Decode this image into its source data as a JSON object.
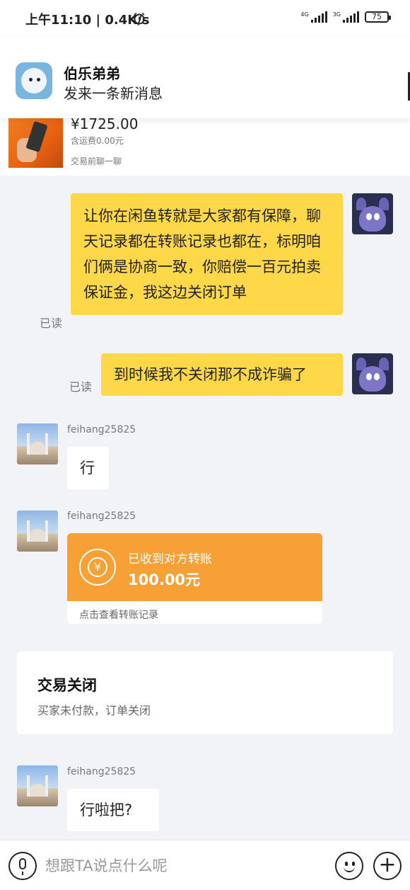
{
  "status_bar": {
    "time": "上午11:10 | 0.4K/s",
    "alarm_icon": "alarm-clock-icon",
    "net1": "4G",
    "net2": "3G",
    "battery": "75"
  },
  "notification": {
    "title": "伯乐弟弟",
    "body": "发来一条新消息",
    "app_icon": "app-mascot-icon"
  },
  "product": {
    "price": "¥1725.00",
    "shipping": "含运费0.00元",
    "chat_hint": "交易前聊一聊"
  },
  "messages": {
    "m1": {
      "text": "让你在闲鱼转就是大家都有保障，聊天记录都在转账记录也都在，标明咱们俩是协商一致，你赔偿一百元拍卖保证金，我这边关闭订单",
      "read": "已读"
    },
    "m2": {
      "text": "到时候我不关闭那不成诈骗了",
      "read": "已读"
    },
    "m3": {
      "nick": "feihang25825",
      "text": "行"
    },
    "m4": {
      "nick": "feihang25825",
      "transfer_status": "已收到对方转账",
      "transfer_amount": "100.00元",
      "transfer_link": "点击查看转账记录"
    },
    "m6": {
      "nick": "feihang25825",
      "text": "行啦把?"
    }
  },
  "system_card": {
    "title": "交易关闭",
    "subtitle": "买家未付款，订单关闭"
  },
  "input_bar": {
    "placeholder": "想跟TA说点什么呢",
    "plus": "+"
  },
  "colors": {
    "accent_yellow": "#ffd84a",
    "transfer_orange": "#f7a035",
    "background": "#f2f3f7"
  }
}
